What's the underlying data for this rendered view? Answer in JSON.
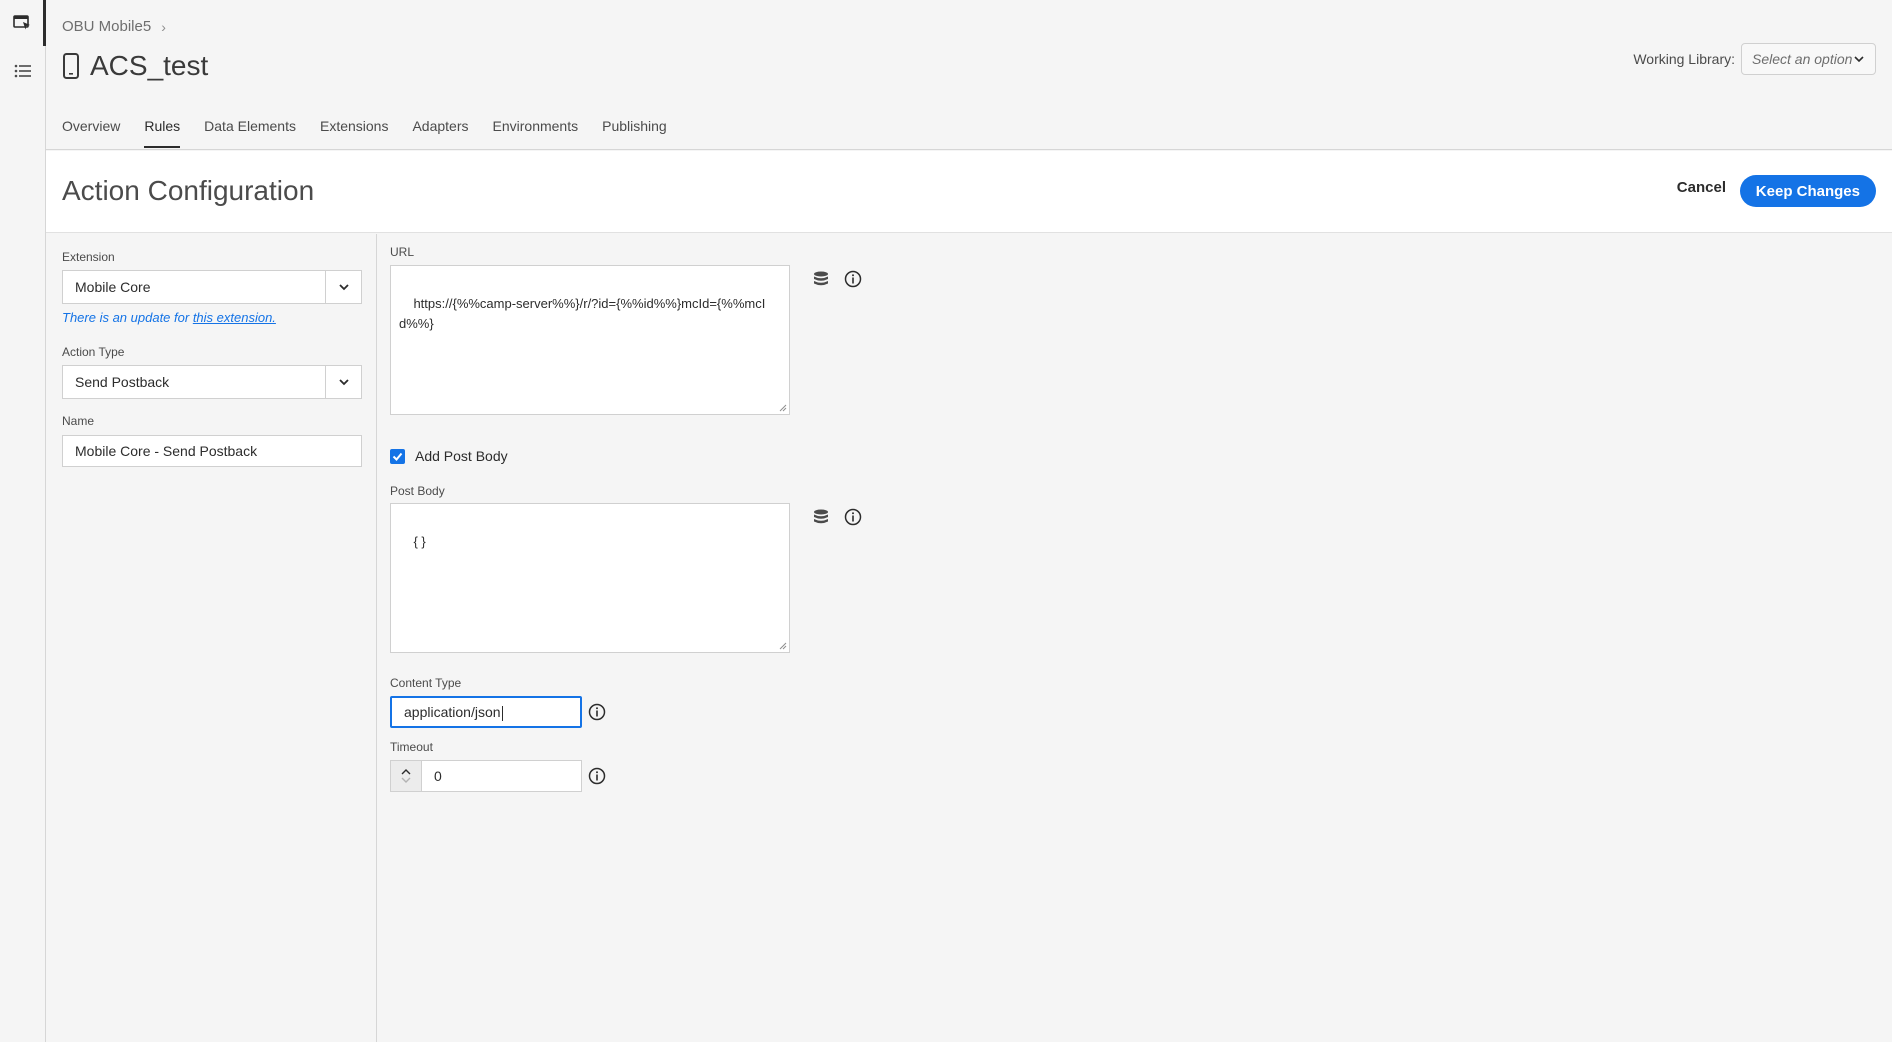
{
  "header": {
    "breadcrumb": "OBU Mobile5",
    "property_name": "ACS_test",
    "working_library_label": "Working Library:",
    "working_library_placeholder": "Select an option",
    "tabs": [
      {
        "label": "Overview"
      },
      {
        "label": "Rules",
        "active": true
      },
      {
        "label": "Data Elements"
      },
      {
        "label": "Extensions"
      },
      {
        "label": "Adapters"
      },
      {
        "label": "Environments"
      },
      {
        "label": "Publishing"
      }
    ]
  },
  "config": {
    "title": "Action Configuration",
    "cancel_label": "Cancel",
    "keep_label": "Keep Changes"
  },
  "left": {
    "extension_label": "Extension",
    "extension_value": "Mobile Core",
    "update_note": "There is an update for ",
    "update_link": "this extension.",
    "action_type_label": "Action Type",
    "action_type_value": "Send Postback",
    "name_label": "Name",
    "name_value": "Mobile Core - Send Postback"
  },
  "main": {
    "url_label": "URL",
    "url_value": "https://{%%camp-server%%}/r/?id={%%id%%}mcId={%%mcId%%}",
    "add_post_body_label": "Add Post Body",
    "add_post_body_checked": true,
    "post_body_label": "Post Body",
    "post_body_value": "{ }",
    "content_type_label": "Content Type",
    "content_type_value": "application/json",
    "timeout_label": "Timeout",
    "timeout_value": "0"
  },
  "colors": {
    "accent": "#1473e6",
    "background": "#f5f5f5"
  }
}
